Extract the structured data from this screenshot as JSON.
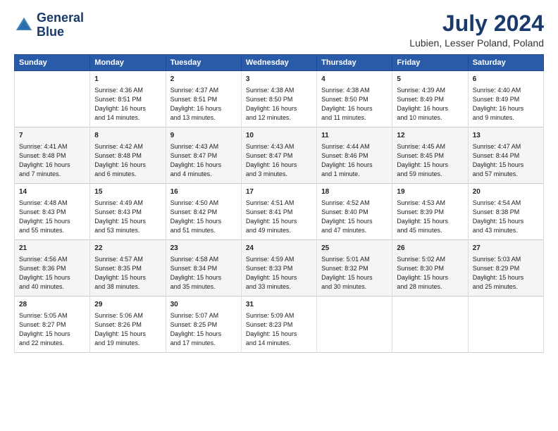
{
  "header": {
    "logo_line1": "General",
    "logo_line2": "Blue",
    "title": "July 2024",
    "subtitle": "Lubien, Lesser Poland, Poland"
  },
  "columns": [
    "Sunday",
    "Monday",
    "Tuesday",
    "Wednesday",
    "Thursday",
    "Friday",
    "Saturday"
  ],
  "rows": [
    [
      {
        "day": "",
        "content": ""
      },
      {
        "day": "1",
        "content": "Sunrise: 4:36 AM\nSunset: 8:51 PM\nDaylight: 16 hours\nand 14 minutes."
      },
      {
        "day": "2",
        "content": "Sunrise: 4:37 AM\nSunset: 8:51 PM\nDaylight: 16 hours\nand 13 minutes."
      },
      {
        "day": "3",
        "content": "Sunrise: 4:38 AM\nSunset: 8:50 PM\nDaylight: 16 hours\nand 12 minutes."
      },
      {
        "day": "4",
        "content": "Sunrise: 4:38 AM\nSunset: 8:50 PM\nDaylight: 16 hours\nand 11 minutes."
      },
      {
        "day": "5",
        "content": "Sunrise: 4:39 AM\nSunset: 8:49 PM\nDaylight: 16 hours\nand 10 minutes."
      },
      {
        "day": "6",
        "content": "Sunrise: 4:40 AM\nSunset: 8:49 PM\nDaylight: 16 hours\nand 9 minutes."
      }
    ],
    [
      {
        "day": "7",
        "content": "Sunrise: 4:41 AM\nSunset: 8:48 PM\nDaylight: 16 hours\nand 7 minutes."
      },
      {
        "day": "8",
        "content": "Sunrise: 4:42 AM\nSunset: 8:48 PM\nDaylight: 16 hours\nand 6 minutes."
      },
      {
        "day": "9",
        "content": "Sunrise: 4:43 AM\nSunset: 8:47 PM\nDaylight: 16 hours\nand 4 minutes."
      },
      {
        "day": "10",
        "content": "Sunrise: 4:43 AM\nSunset: 8:47 PM\nDaylight: 16 hours\nand 3 minutes."
      },
      {
        "day": "11",
        "content": "Sunrise: 4:44 AM\nSunset: 8:46 PM\nDaylight: 16 hours\nand 1 minute."
      },
      {
        "day": "12",
        "content": "Sunrise: 4:45 AM\nSunset: 8:45 PM\nDaylight: 15 hours\nand 59 minutes."
      },
      {
        "day": "13",
        "content": "Sunrise: 4:47 AM\nSunset: 8:44 PM\nDaylight: 15 hours\nand 57 minutes."
      }
    ],
    [
      {
        "day": "14",
        "content": "Sunrise: 4:48 AM\nSunset: 8:43 PM\nDaylight: 15 hours\nand 55 minutes."
      },
      {
        "day": "15",
        "content": "Sunrise: 4:49 AM\nSunset: 8:43 PM\nDaylight: 15 hours\nand 53 minutes."
      },
      {
        "day": "16",
        "content": "Sunrise: 4:50 AM\nSunset: 8:42 PM\nDaylight: 15 hours\nand 51 minutes."
      },
      {
        "day": "17",
        "content": "Sunrise: 4:51 AM\nSunset: 8:41 PM\nDaylight: 15 hours\nand 49 minutes."
      },
      {
        "day": "18",
        "content": "Sunrise: 4:52 AM\nSunset: 8:40 PM\nDaylight: 15 hours\nand 47 minutes."
      },
      {
        "day": "19",
        "content": "Sunrise: 4:53 AM\nSunset: 8:39 PM\nDaylight: 15 hours\nand 45 minutes."
      },
      {
        "day": "20",
        "content": "Sunrise: 4:54 AM\nSunset: 8:38 PM\nDaylight: 15 hours\nand 43 minutes."
      }
    ],
    [
      {
        "day": "21",
        "content": "Sunrise: 4:56 AM\nSunset: 8:36 PM\nDaylight: 15 hours\nand 40 minutes."
      },
      {
        "day": "22",
        "content": "Sunrise: 4:57 AM\nSunset: 8:35 PM\nDaylight: 15 hours\nand 38 minutes."
      },
      {
        "day": "23",
        "content": "Sunrise: 4:58 AM\nSunset: 8:34 PM\nDaylight: 15 hours\nand 35 minutes."
      },
      {
        "day": "24",
        "content": "Sunrise: 4:59 AM\nSunset: 8:33 PM\nDaylight: 15 hours\nand 33 minutes."
      },
      {
        "day": "25",
        "content": "Sunrise: 5:01 AM\nSunset: 8:32 PM\nDaylight: 15 hours\nand 30 minutes."
      },
      {
        "day": "26",
        "content": "Sunrise: 5:02 AM\nSunset: 8:30 PM\nDaylight: 15 hours\nand 28 minutes."
      },
      {
        "day": "27",
        "content": "Sunrise: 5:03 AM\nSunset: 8:29 PM\nDaylight: 15 hours\nand 25 minutes."
      }
    ],
    [
      {
        "day": "28",
        "content": "Sunrise: 5:05 AM\nSunset: 8:27 PM\nDaylight: 15 hours\nand 22 minutes."
      },
      {
        "day": "29",
        "content": "Sunrise: 5:06 AM\nSunset: 8:26 PM\nDaylight: 15 hours\nand 19 minutes."
      },
      {
        "day": "30",
        "content": "Sunrise: 5:07 AM\nSunset: 8:25 PM\nDaylight: 15 hours\nand 17 minutes."
      },
      {
        "day": "31",
        "content": "Sunrise: 5:09 AM\nSunset: 8:23 PM\nDaylight: 15 hours\nand 14 minutes."
      },
      {
        "day": "",
        "content": ""
      },
      {
        "day": "",
        "content": ""
      },
      {
        "day": "",
        "content": ""
      }
    ]
  ]
}
